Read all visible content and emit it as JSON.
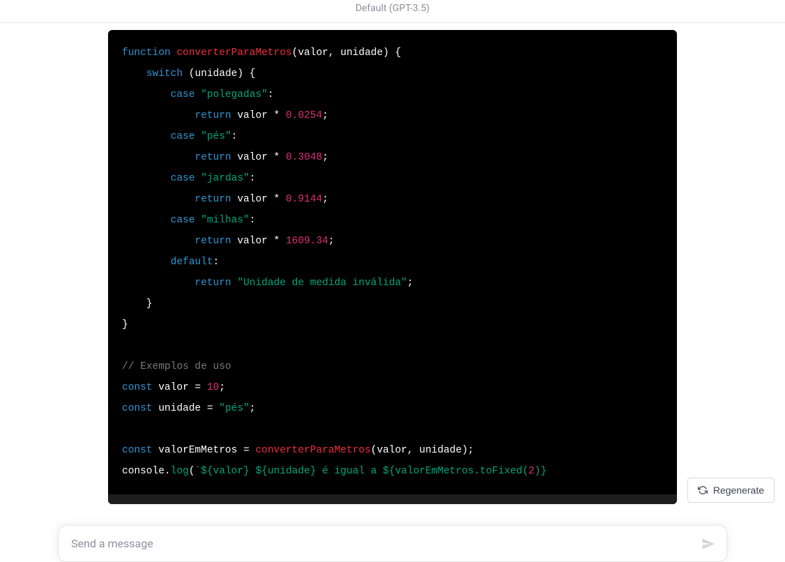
{
  "header": {
    "model_label": "Default (GPT-3.5)"
  },
  "code": {
    "tokens": [
      [
        [
          "keyword",
          "function"
        ],
        [
          "punct",
          " "
        ],
        [
          "function-name",
          "converterParaMetros"
        ],
        [
          "punct",
          "("
        ],
        [
          "var",
          "valor"
        ],
        [
          "punct",
          ", "
        ],
        [
          "var",
          "unidade"
        ],
        [
          "punct",
          ") {"
        ]
      ],
      [
        [
          "punct",
          "    "
        ],
        [
          "keyword",
          "switch"
        ],
        [
          "punct",
          " ("
        ],
        [
          "var",
          "unidade"
        ],
        [
          "punct",
          ") {"
        ]
      ],
      [
        [
          "punct",
          "        "
        ],
        [
          "keyword",
          "case"
        ],
        [
          "punct",
          " "
        ],
        [
          "string",
          "\"polegadas\""
        ],
        [
          "punct",
          ":"
        ]
      ],
      [
        [
          "punct",
          "            "
        ],
        [
          "keyword",
          "return"
        ],
        [
          "punct",
          " "
        ],
        [
          "var",
          "valor"
        ],
        [
          "punct",
          " * "
        ],
        [
          "number",
          "0.0254"
        ],
        [
          "punct",
          ";"
        ]
      ],
      [
        [
          "punct",
          "        "
        ],
        [
          "keyword",
          "case"
        ],
        [
          "punct",
          " "
        ],
        [
          "string",
          "\"pés\""
        ],
        [
          "punct",
          ":"
        ]
      ],
      [
        [
          "punct",
          "            "
        ],
        [
          "keyword",
          "return"
        ],
        [
          "punct",
          " "
        ],
        [
          "var",
          "valor"
        ],
        [
          "punct",
          " * "
        ],
        [
          "number",
          "0.3048"
        ],
        [
          "punct",
          ";"
        ]
      ],
      [
        [
          "punct",
          "        "
        ],
        [
          "keyword",
          "case"
        ],
        [
          "punct",
          " "
        ],
        [
          "string",
          "\"jardas\""
        ],
        [
          "punct",
          ":"
        ]
      ],
      [
        [
          "punct",
          "            "
        ],
        [
          "keyword",
          "return"
        ],
        [
          "punct",
          " "
        ],
        [
          "var",
          "valor"
        ],
        [
          "punct",
          " * "
        ],
        [
          "number",
          "0.9144"
        ],
        [
          "punct",
          ";"
        ]
      ],
      [
        [
          "punct",
          "        "
        ],
        [
          "keyword",
          "case"
        ],
        [
          "punct",
          " "
        ],
        [
          "string",
          "\"milhas\""
        ],
        [
          "punct",
          ":"
        ]
      ],
      [
        [
          "punct",
          "            "
        ],
        [
          "keyword",
          "return"
        ],
        [
          "punct",
          " "
        ],
        [
          "var",
          "valor"
        ],
        [
          "punct",
          " * "
        ],
        [
          "number",
          "1609.34"
        ],
        [
          "punct",
          ";"
        ]
      ],
      [
        [
          "punct",
          "        "
        ],
        [
          "keyword",
          "default"
        ],
        [
          "punct",
          ":"
        ]
      ],
      [
        [
          "punct",
          "            "
        ],
        [
          "keyword",
          "return"
        ],
        [
          "punct",
          " "
        ],
        [
          "string",
          "\"Unidade de medida inválida\""
        ],
        [
          "punct",
          ";"
        ]
      ],
      [
        [
          "punct",
          "    }"
        ]
      ],
      [
        [
          "punct",
          "}"
        ]
      ],
      [
        [
          "punct",
          ""
        ]
      ],
      [
        [
          "comment",
          "// Exemplos de uso"
        ]
      ],
      [
        [
          "keyword",
          "const"
        ],
        [
          "punct",
          " "
        ],
        [
          "var",
          "valor"
        ],
        [
          "punct",
          " = "
        ],
        [
          "number",
          "10"
        ],
        [
          "punct",
          ";"
        ]
      ],
      [
        [
          "keyword",
          "const"
        ],
        [
          "punct",
          " "
        ],
        [
          "var",
          "unidade"
        ],
        [
          "punct",
          " = "
        ],
        [
          "string",
          "\"pés\""
        ],
        [
          "punct",
          ";"
        ]
      ],
      [
        [
          "punct",
          ""
        ]
      ],
      [
        [
          "keyword",
          "const"
        ],
        [
          "punct",
          " "
        ],
        [
          "var",
          "valorEmMetros"
        ],
        [
          "punct",
          " = "
        ],
        [
          "function-name",
          "converterParaMetros"
        ],
        [
          "punct",
          "("
        ],
        [
          "var",
          "valor"
        ],
        [
          "punct",
          ", "
        ],
        [
          "var",
          "unidade"
        ],
        [
          "punct",
          ");"
        ]
      ],
      [
        [
          "var",
          "console"
        ],
        [
          "punct",
          "."
        ],
        [
          "method",
          "log"
        ],
        [
          "punct",
          "("
        ],
        [
          "string",
          "`${valor} ${unidade} é igual a ${valorEmMetros.toFixed("
        ],
        [
          "number",
          "2"
        ],
        [
          "string",
          ")}"
        ]
      ]
    ]
  },
  "actions": {
    "regenerate_label": "Regenerate"
  },
  "input": {
    "placeholder": "Send a message"
  }
}
